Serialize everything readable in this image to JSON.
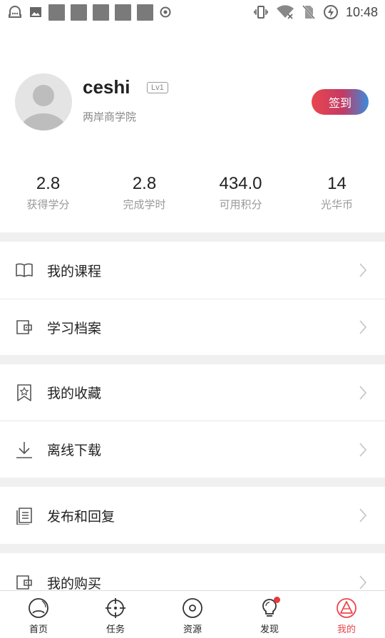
{
  "status_bar": {
    "time": "10:48"
  },
  "profile": {
    "username": "ceshi",
    "level": "Lv1",
    "school": "两岸商学院",
    "checkin_label": "签到"
  },
  "stats": [
    {
      "value": "2.8",
      "label": "获得学分"
    },
    {
      "value": "2.8",
      "label": "完成学时"
    },
    {
      "value": "434.0",
      "label": "可用积分"
    },
    {
      "value": "14",
      "label": "光华币"
    }
  ],
  "menu": [
    {
      "label": "我的课程",
      "icon": "book-icon"
    },
    {
      "label": "学习档案",
      "icon": "folder-icon"
    },
    {
      "label": "我的收藏",
      "icon": "bookmark-star-icon"
    },
    {
      "label": "离线下载",
      "icon": "download-icon"
    },
    {
      "label": "发布和回复",
      "icon": "document-list-icon"
    },
    {
      "label": "我的购买",
      "icon": "wallet-icon"
    }
  ],
  "bottom_nav": [
    {
      "label": "首页",
      "icon": "home-icon"
    },
    {
      "label": "任务",
      "icon": "target-icon"
    },
    {
      "label": "资源",
      "icon": "disc-icon"
    },
    {
      "label": "发现",
      "icon": "lightbulb-icon"
    },
    {
      "label": "我的",
      "icon": "profile-icon",
      "active": true
    }
  ],
  "colors": {
    "accent": "#e9464e",
    "accent_blue": "#3a8cdc",
    "gap": "#f0f0f0"
  }
}
